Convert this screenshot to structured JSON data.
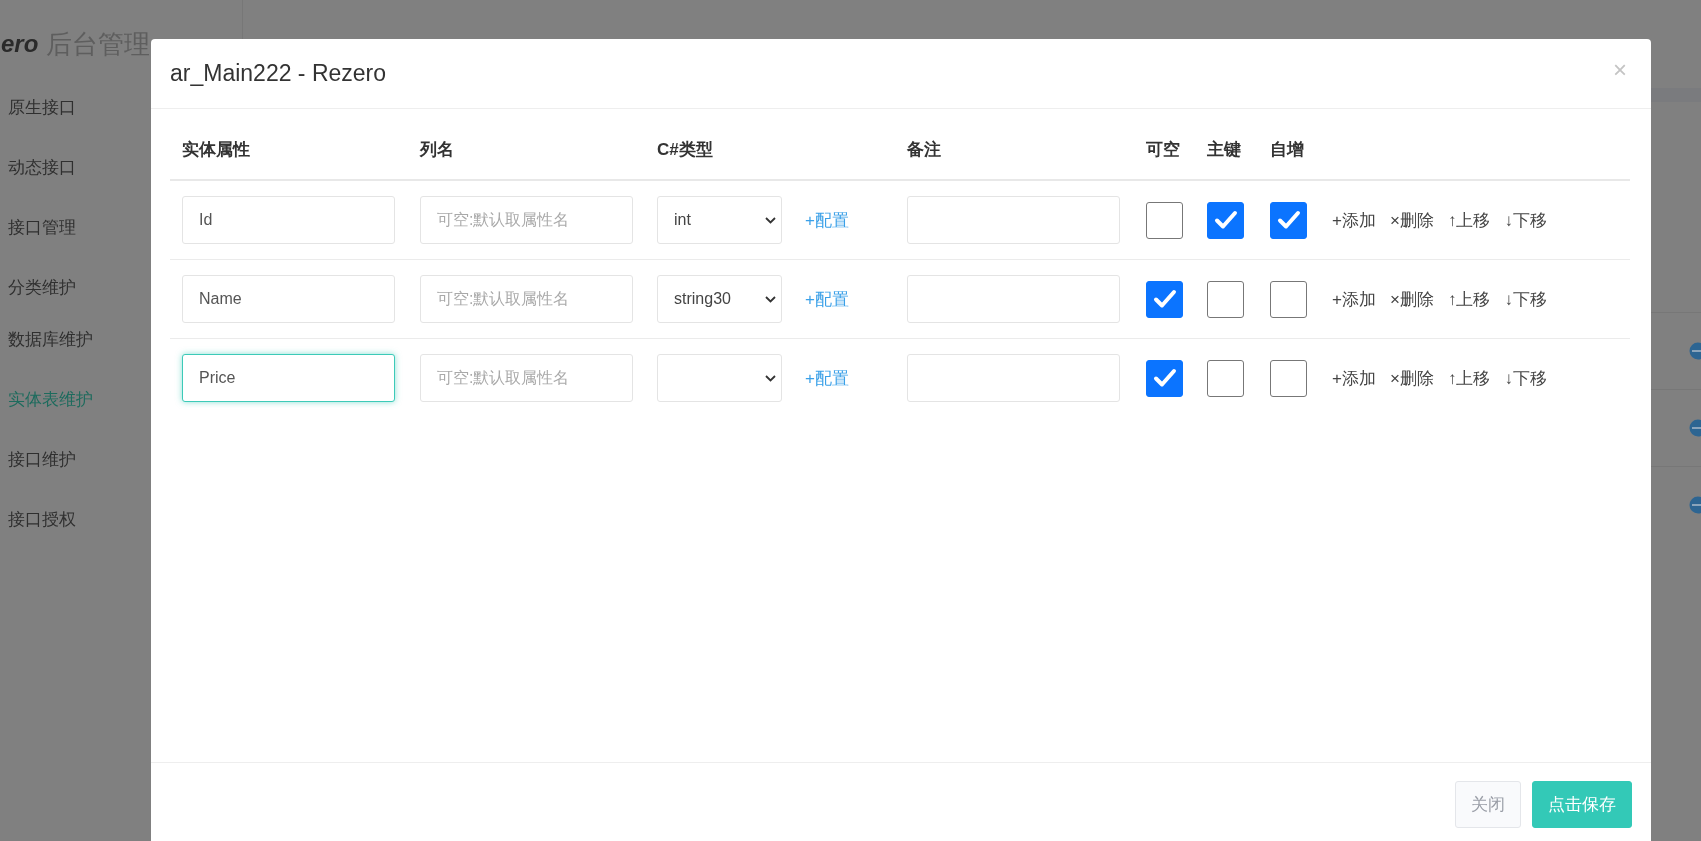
{
  "app": {
    "logo": "ero",
    "title": "后台管理"
  },
  "sidebar": {
    "items": [
      {
        "label": "原生接口",
        "selected": false
      },
      {
        "label": "动态接口",
        "selected": false
      },
      {
        "label": "接口管理",
        "selected": false
      },
      {
        "label": "分类维护",
        "selected": false
      },
      {
        "label": "数据库维护",
        "selected": false
      },
      {
        "label": "实体表维护",
        "selected": true
      },
      {
        "label": "接口维护",
        "selected": false
      },
      {
        "label": "接口授权",
        "selected": false
      }
    ]
  },
  "dialog": {
    "title": "ar_Main222 - Rezero",
    "close": "×",
    "columns": [
      "实体属性",
      "列名",
      "C#类型",
      "备注",
      "可空",
      "主键",
      "自增"
    ],
    "rows": [
      {
        "property": "Id",
        "focused": false,
        "column_name_placeholder": "可空:默认取属性名",
        "type": "int",
        "config_link": "+配置",
        "nullable": false,
        "primary_key": true,
        "identity": true,
        "actions": [
          "+添加",
          "×删除",
          "↑上移",
          "↓下移"
        ]
      },
      {
        "property": "Name",
        "focused": false,
        "column_name_placeholder": "可空:默认取属性名",
        "type": "string30",
        "config_link": "+配置",
        "nullable": true,
        "primary_key": false,
        "identity": false,
        "actions": [
          "+添加",
          "×删除",
          "↑上移",
          "↓下移"
        ]
      },
      {
        "property": "Price",
        "focused": true,
        "column_name_placeholder": "可空:默认取属性名",
        "config_link": "+配置",
        "nullable": true,
        "primary_key": false,
        "identity": false,
        "actions": [
          "+添加",
          "×删除",
          "↑上移",
          "↓下移"
        ]
      }
    ],
    "buttons": [
      {
        "label": "关闭",
        "kind": "secondary"
      },
      {
        "label": "点击保存",
        "kind": "primary"
      }
    ]
  }
}
